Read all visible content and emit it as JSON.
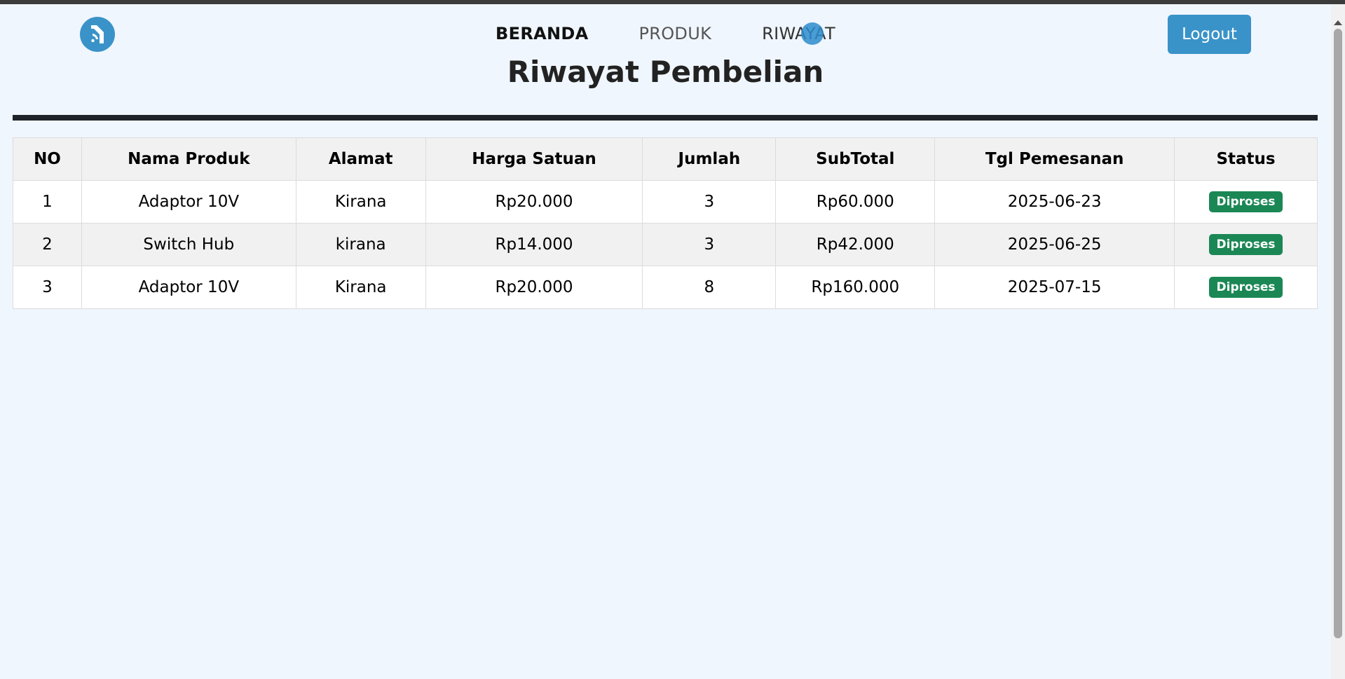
{
  "nav": {
    "items": [
      {
        "label": "BERANDA"
      },
      {
        "label": "PRODUK"
      },
      {
        "label": "RIWAYAT"
      }
    ],
    "logout_label": "Logout"
  },
  "page_title": "Riwayat Pembelian",
  "table": {
    "headers": [
      "NO",
      "Nama Produk",
      "Alamat",
      "Harga Satuan",
      "Jumlah",
      "SubTotal",
      "Tgl Pemesanan",
      "Status"
    ],
    "rows": [
      [
        "1",
        "Adaptor 10V",
        "Kirana",
        "Rp20.000",
        "3",
        "Rp60.000",
        "2025-06-23",
        "Diproses"
      ],
      [
        "2",
        "Switch Hub",
        "kirana",
        "Rp14.000",
        "3",
        "Rp42.000",
        "2025-06-25",
        "Diproses"
      ],
      [
        "3",
        "Adaptor 10V",
        "Kirana",
        "Rp20.000",
        "8",
        "Rp160.000",
        "2025-07-15",
        "Diproses"
      ]
    ]
  },
  "colors": {
    "accent": "#3a93c8",
    "status_badge": "#1b8755",
    "background": "#f0f6fe"
  },
  "icons": {
    "logo": "rss-logo-icon"
  }
}
